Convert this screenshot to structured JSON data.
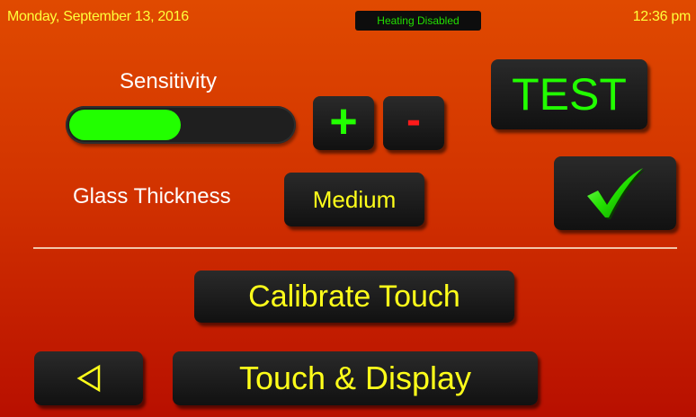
{
  "header": {
    "date": "Monday, September 13, 2016",
    "status": "Heating Disabled",
    "time": "12:36 pm"
  },
  "sensitivity": {
    "label": "Sensitivity",
    "level": 0.5,
    "increase_label": "+",
    "decrease_label": "-"
  },
  "test_button": {
    "label": "TEST"
  },
  "glass": {
    "label": "Glass Thickness",
    "value": "Medium"
  },
  "confirm_button": {
    "icon": "checkmark-icon"
  },
  "calibrate_button": {
    "label": "Calibrate Touch"
  },
  "back_button": {
    "icon": "back-arrow-icon"
  },
  "touch_display_button": {
    "label": "Touch & Display"
  },
  "colors": {
    "text_yellow": "#ffff1a",
    "accent_green": "#22ff00",
    "minus_red": "#ff1a1a",
    "background_top": "#e04a00",
    "background_bottom": "#b80f00",
    "button_dark": "#111111"
  }
}
